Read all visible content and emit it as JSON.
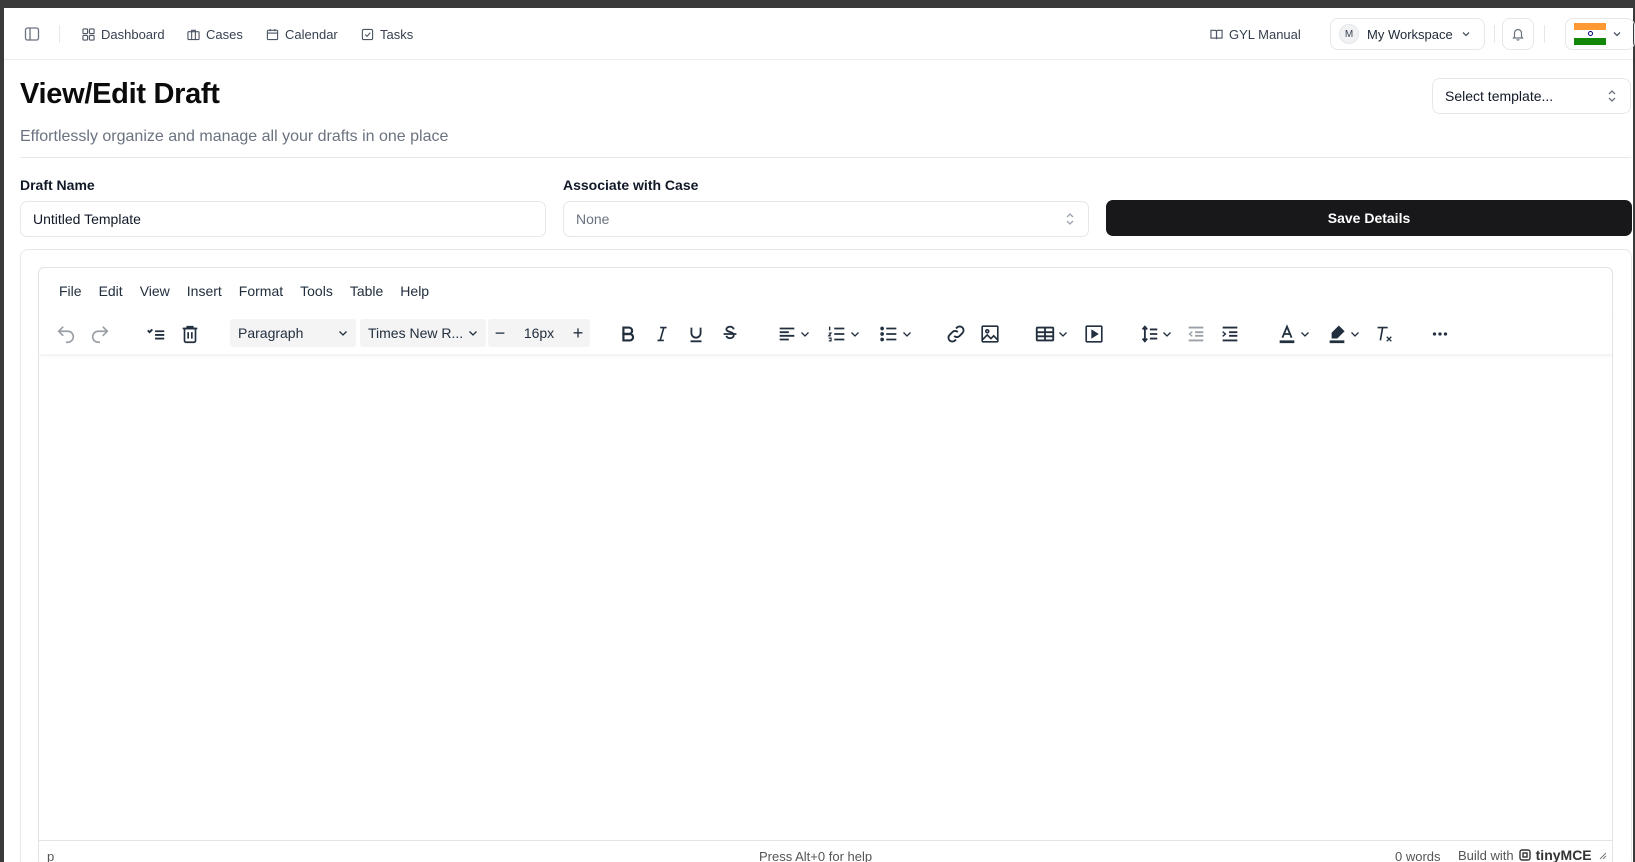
{
  "nav": {
    "items": [
      {
        "label": "Dashboard",
        "icon": "dashboard-icon"
      },
      {
        "label": "Cases",
        "icon": "briefcase-icon"
      },
      {
        "label": "Calendar",
        "icon": "calendar-icon"
      },
      {
        "label": "Tasks",
        "icon": "checkbox-icon"
      }
    ],
    "manual_label": "GYL Manual",
    "workspace_initial": "M",
    "workspace_label": "My Workspace",
    "flag_colors": [
      "#FF9933",
      "#FFFFFF",
      "#138808"
    ]
  },
  "header": {
    "title": "View/Edit Draft",
    "subtitle": "Effortlessly organize and manage all your drafts in one place",
    "template_placeholder": "Select template..."
  },
  "form": {
    "draft_name_label": "Draft Name",
    "draft_name_value": "Untitled Template",
    "case_label": "Associate with Case",
    "case_value": "None",
    "save_label": "Save Details",
    "save_color": "#18181B"
  },
  "editor": {
    "menus": [
      "File",
      "Edit",
      "View",
      "Insert",
      "Format",
      "Tools",
      "Table",
      "Help"
    ],
    "block_format": "Paragraph",
    "font_family": "Times New R...",
    "font_size": "16px",
    "status_path": "p",
    "status_help": "Press Alt+0 for help",
    "word_count": "0 words",
    "build_with": "Build with",
    "brand": "tinyMCE"
  }
}
